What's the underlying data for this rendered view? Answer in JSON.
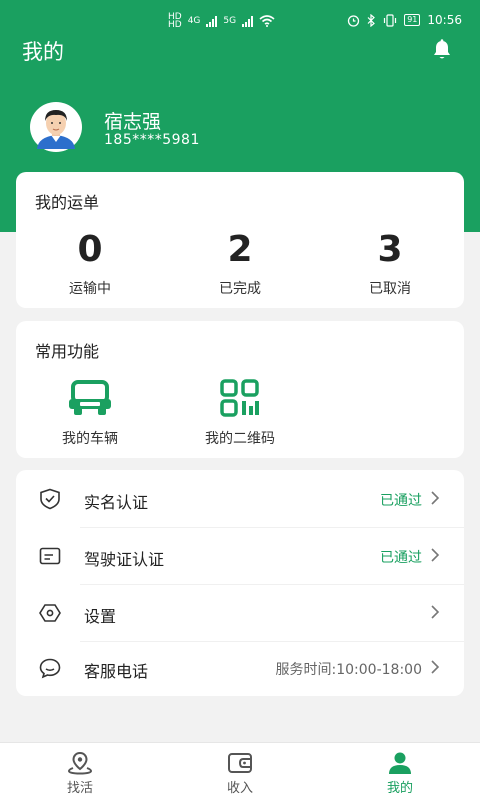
{
  "status_bar": {
    "hd1": "HD",
    "net1": "4G",
    "hd2": "HD",
    "net2": "5G",
    "battery": "91",
    "time": "10:56"
  },
  "header": {
    "title": "我的"
  },
  "user": {
    "name": "宿志强",
    "phone": "185****5981"
  },
  "orders": {
    "title": "我的运单",
    "stats": [
      {
        "value": "0",
        "label": "运输中"
      },
      {
        "value": "2",
        "label": "已完成"
      },
      {
        "value": "3",
        "label": "已取消"
      }
    ]
  },
  "functions": {
    "title": "常用功能",
    "items": [
      {
        "label": "我的车辆",
        "icon": "vehicle-icon"
      },
      {
        "label": "我的二维码",
        "icon": "qrcode-icon"
      }
    ]
  },
  "menu": [
    {
      "label": "实名认证",
      "value": "已通过",
      "icon": "shield-check-icon"
    },
    {
      "label": "驾驶证认证",
      "value": "已通过",
      "icon": "license-card-icon"
    },
    {
      "label": "设置",
      "value": "",
      "icon": "settings-icon"
    },
    {
      "label": "客服电话",
      "value": "服务时间:10:00-18:00",
      "icon": "chat-icon"
    }
  ],
  "tabbar": [
    {
      "label": "找活",
      "icon": "location-icon",
      "active": false
    },
    {
      "label": "收入",
      "icon": "wallet-icon",
      "active": false
    },
    {
      "label": "我的",
      "icon": "person-icon",
      "active": true
    }
  ],
  "colors": {
    "primary": "#1aa060",
    "inactive": "#555555",
    "background": "#f2f2f2"
  }
}
